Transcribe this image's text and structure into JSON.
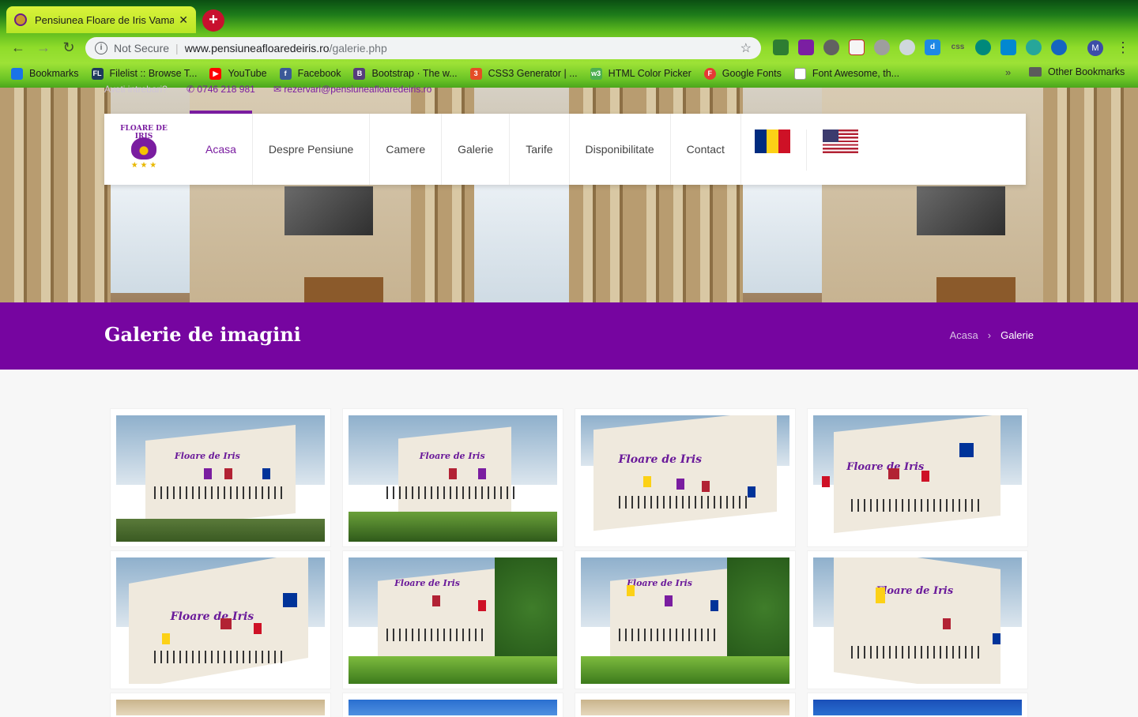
{
  "browser": {
    "tab_title": "Pensiunea Floare de Iris Vama",
    "tab_close": "✕",
    "new_tab": "+",
    "back": "←",
    "forward": "→",
    "reload": "↻",
    "security_label": "Not Secure",
    "url_domain": "www.pensiuneafloaredeiris.ro",
    "url_path": "/galerie.php",
    "star": "☆",
    "profile_initial": "M",
    "menu": "⋮",
    "bookmarks": [
      {
        "label": "Bookmarks",
        "icon": "star-icon",
        "color": "#1a73e8"
      },
      {
        "label": "Filelist :: Browse T...",
        "icon": "filelist-icon",
        "color": "#1e3a5c"
      },
      {
        "label": "YouTube",
        "icon": "youtube-icon",
        "color": "#ff0000"
      },
      {
        "label": "Facebook",
        "icon": "facebook-icon",
        "color": "#3b5998"
      },
      {
        "label": "Bootstrap · The w...",
        "icon": "bootstrap-icon",
        "color": "#563d7c"
      },
      {
        "label": "CSS3 Generator | ...",
        "icon": "css3-icon",
        "color": "#e44d26"
      },
      {
        "label": "HTML Color Picker",
        "icon": "w3-icon",
        "color": "#4caf50"
      },
      {
        "label": "Google Fonts",
        "icon": "google-fonts-icon",
        "color": "#e53935"
      },
      {
        "label": "Font Awesome, th...",
        "icon": "page-icon",
        "color": "#9e9e9e"
      }
    ],
    "bookmarks_more": "»",
    "other_bookmarks": "Other Bookmarks"
  },
  "topbar": {
    "question": "Aveti intrebari?",
    "phone": "0746 218 981",
    "email": "rezervari@pensiuneafloaredeiris.ro"
  },
  "logo": {
    "text": "FLOARE DE IRIS",
    "stars": "★ ★ ★"
  },
  "nav": {
    "items": [
      "Acasa",
      "Despre Pensiune",
      "Camere",
      "Galerie",
      "Tarife",
      "Disponibilitate",
      "Contact"
    ],
    "active": "Acasa"
  },
  "colors": {
    "brand_purple": "#7605a0",
    "accent_purple": "#7a1da0"
  },
  "page": {
    "title": "Galerie de imagini",
    "breadcrumb_home": "Acasa",
    "breadcrumb_sep": "›",
    "breadcrumb_current": "Galerie"
  }
}
